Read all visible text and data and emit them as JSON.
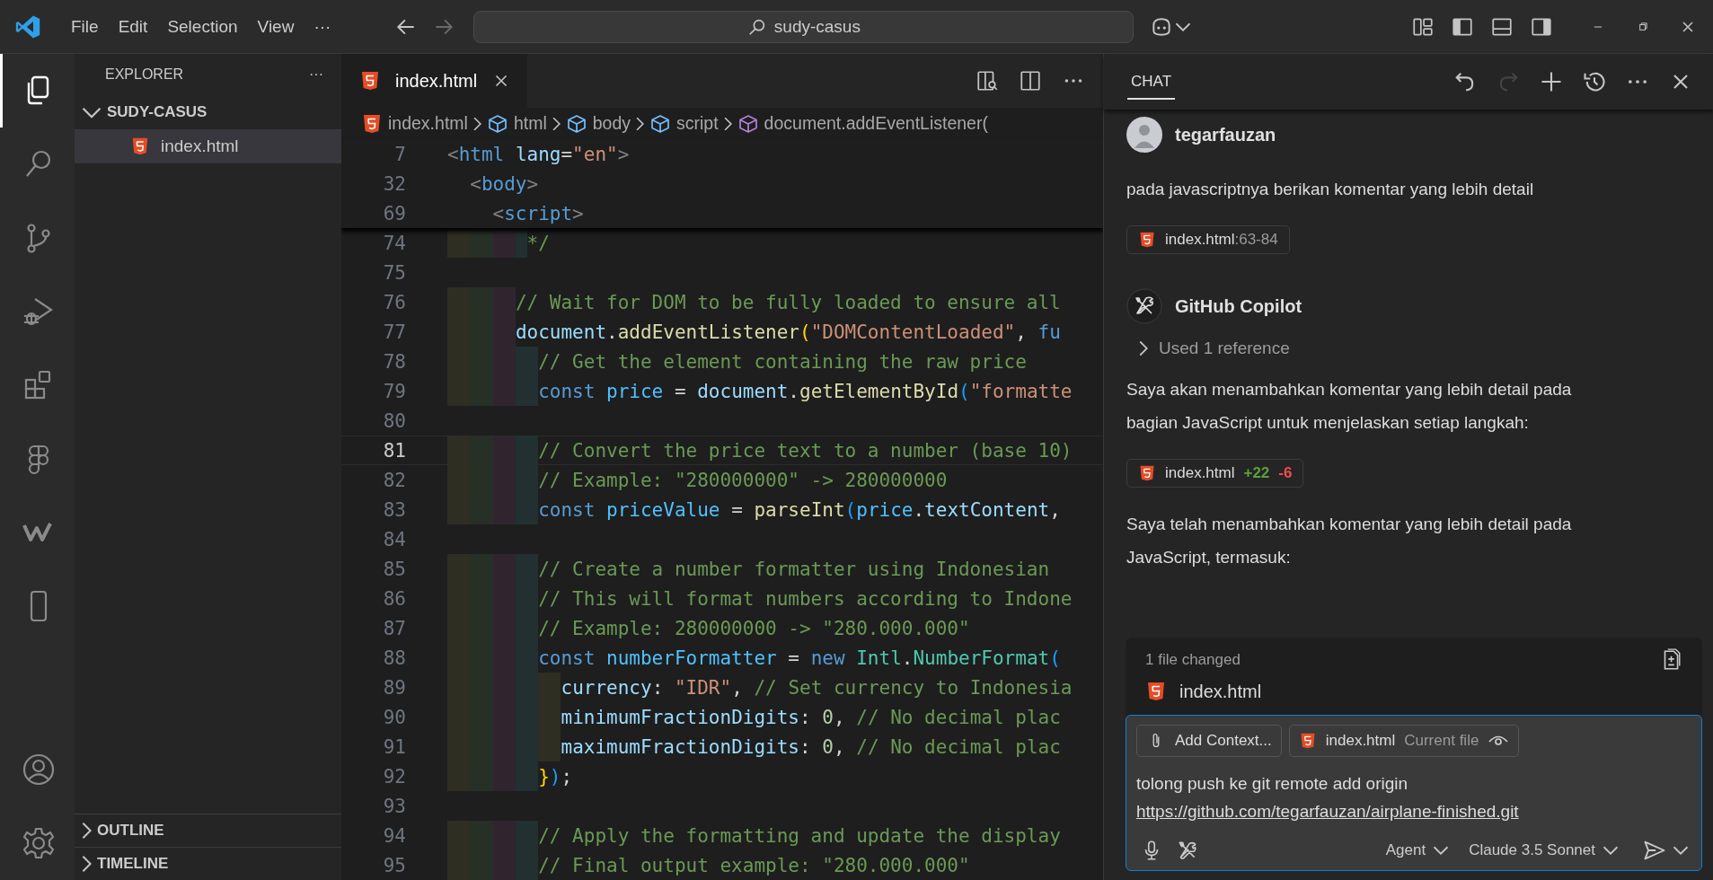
{
  "title_bar": {
    "menus": [
      "File",
      "Edit",
      "Selection",
      "View",
      "···"
    ],
    "search": "sudy-casus"
  },
  "activity_bar": {
    "items": [
      {
        "kind": "files",
        "selected": true
      },
      {
        "kind": "search",
        "selected": false
      },
      {
        "kind": "branch",
        "selected": false
      },
      {
        "kind": "debug",
        "selected": false
      },
      {
        "kind": "extensions",
        "selected": false
      },
      {
        "kind": "figma",
        "selected": false
      },
      {
        "kind": "wave",
        "selected": false
      },
      {
        "kind": "phone",
        "selected": false
      }
    ],
    "bottom": [
      {
        "kind": "account"
      },
      {
        "kind": "gear"
      }
    ]
  },
  "sidebar": {
    "title": "EXPLORER",
    "more": "···",
    "folder": {
      "name": "SUDY-CASUS",
      "expanded": true,
      "children": [
        {
          "name": "index.html",
          "selected": true
        }
      ]
    },
    "sections": [
      {
        "name": "OUTLINE",
        "expanded": false
      },
      {
        "name": "TIMELINE",
        "expanded": false
      }
    ]
  },
  "editor": {
    "tabs": [
      {
        "label": "index.html",
        "selected": true
      }
    ],
    "breadcrumb": [
      {
        "kind": "file",
        "text": "index.html"
      },
      {
        "kind": "element",
        "text": "html"
      },
      {
        "kind": "element",
        "text": "body"
      },
      {
        "kind": "element",
        "text": "script"
      },
      {
        "kind": "method",
        "text": "document.addEventListener("
      }
    ],
    "sticky_lines": [
      {
        "number": "7",
        "tokens": [
          {
            "kind": "tagpunct",
            "text": "<"
          },
          {
            "kind": "tag",
            "text": "html"
          },
          {
            "kind": "attr",
            "text": " lang"
          },
          {
            "kind": "plain",
            "text": "="
          },
          {
            "kind": "string",
            "text": "\"en\""
          },
          {
            "kind": "tagpunct",
            "text": ">"
          }
        ]
      },
      {
        "number": "32",
        "tokens": [
          {
            "kind": "tagpunct",
            "text": "  <"
          },
          {
            "kind": "tag",
            "text": "body"
          },
          {
            "kind": "tagpunct",
            "text": ">"
          }
        ]
      },
      {
        "number": "69",
        "tokens": [
          {
            "kind": "tagpunct",
            "text": "    <"
          },
          {
            "kind": "tag",
            "text": "script"
          },
          {
            "kind": "tagpunct",
            "text": ">"
          }
        ]
      }
    ],
    "lines": [
      {
        "number": "74",
        "current": false,
        "tokens": [
          {
            "kind": "comment",
            "text": "       */"
          }
        ]
      },
      {
        "number": "75",
        "current": false
      },
      {
        "number": "76",
        "current": false,
        "tokens": [
          {
            "kind": "comment",
            "text": "      // Wait for DOM to be fully loaded to ensure all"
          }
        ]
      },
      {
        "number": "77",
        "current": false,
        "tokens": [
          {
            "kind": "variable",
            "text": "      document"
          },
          {
            "kind": "plain",
            "text": "."
          },
          {
            "kind": "function",
            "text": "addEventListener"
          },
          {
            "kind": "bracket1",
            "text": "("
          },
          {
            "kind": "string",
            "text": "\"DOMContentLoaded\""
          },
          {
            "kind": "plain",
            "text": ", "
          },
          {
            "kind": "keyword",
            "text": "fu"
          }
        ]
      },
      {
        "number": "78",
        "current": false,
        "tokens": [
          {
            "kind": "comment",
            "text": "        // Get the element containing the raw price"
          }
        ]
      },
      {
        "number": "79",
        "current": false,
        "tokens": [
          {
            "kind": "keyword",
            "text": "        const "
          },
          {
            "kind": "constant",
            "text": "price"
          },
          {
            "kind": "plain",
            "text": " = "
          },
          {
            "kind": "variable",
            "text": "document"
          },
          {
            "kind": "plain",
            "text": "."
          },
          {
            "kind": "function",
            "text": "getElementById"
          },
          {
            "kind": "bracket2",
            "text": "("
          },
          {
            "kind": "string",
            "text": "\"formatte"
          }
        ]
      },
      {
        "number": "80",
        "current": false
      },
      {
        "number": "81",
        "current": true,
        "tokens": [
          {
            "kind": "comment",
            "text": "        // Convert the price text to a number (base 10)"
          }
        ]
      },
      {
        "number": "82",
        "current": false,
        "tokens": [
          {
            "kind": "comment",
            "text": "        // Example: \"280000000\" -> 280000000"
          }
        ]
      },
      {
        "number": "83",
        "current": false,
        "tokens": [
          {
            "kind": "keyword",
            "text": "        const "
          },
          {
            "kind": "constant",
            "text": "priceValue"
          },
          {
            "kind": "plain",
            "text": " = "
          },
          {
            "kind": "function",
            "text": "parseInt"
          },
          {
            "kind": "bracket2",
            "text": "("
          },
          {
            "kind": "constant",
            "text": "price"
          },
          {
            "kind": "plain",
            "text": "."
          },
          {
            "kind": "variable",
            "text": "textContent"
          },
          {
            "kind": "plain",
            "text": ","
          }
        ]
      },
      {
        "number": "84",
        "current": false
      },
      {
        "number": "85",
        "current": false,
        "tokens": [
          {
            "kind": "comment",
            "text": "        // Create a number formatter using Indonesian"
          }
        ]
      },
      {
        "number": "86",
        "current": false,
        "tokens": [
          {
            "kind": "comment",
            "text": "        // This will format numbers according to Indone"
          }
        ]
      },
      {
        "number": "87",
        "current": false,
        "tokens": [
          {
            "kind": "comment",
            "text": "        // Example: 280000000 -> \"280.000.000\""
          }
        ]
      },
      {
        "number": "88",
        "current": false,
        "tokens": [
          {
            "kind": "keyword",
            "text": "        const "
          },
          {
            "kind": "constant",
            "text": "numberFormatter"
          },
          {
            "kind": "plain",
            "text": " = "
          },
          {
            "kind": "keyword",
            "text": "new "
          },
          {
            "kind": "class",
            "text": "Intl"
          },
          {
            "kind": "plain",
            "text": "."
          },
          {
            "kind": "class",
            "text": "NumberFormat"
          },
          {
            "kind": "bracket2",
            "text": "("
          }
        ]
      },
      {
        "number": "89",
        "current": false,
        "tokens": [
          {
            "kind": "variable",
            "text": "          currency"
          },
          {
            "kind": "plain",
            "text": ": "
          },
          {
            "kind": "string",
            "text": "\"IDR\""
          },
          {
            "kind": "plain",
            "text": ", "
          },
          {
            "kind": "comment",
            "text": "// Set currency to Indonesia"
          }
        ]
      },
      {
        "number": "90",
        "current": false,
        "tokens": [
          {
            "kind": "variable",
            "text": "          minimumFractionDigits"
          },
          {
            "kind": "plain",
            "text": ": "
          },
          {
            "kind": "number",
            "text": "0"
          },
          {
            "kind": "plain",
            "text": ", "
          },
          {
            "kind": "comment",
            "text": "// No decimal plac"
          }
        ]
      },
      {
        "number": "91",
        "current": false,
        "tokens": [
          {
            "kind": "variable",
            "text": "          maximumFractionDigits"
          },
          {
            "kind": "plain",
            "text": ": "
          },
          {
            "kind": "number",
            "text": "0"
          },
          {
            "kind": "plain",
            "text": ", "
          },
          {
            "kind": "comment",
            "text": "// No decimal plac"
          }
        ]
      },
      {
        "number": "92",
        "current": false,
        "tokens": [
          {
            "kind": "bracket1",
            "text": "        }"
          },
          {
            "kind": "bracket2",
            "text": ")"
          },
          {
            "kind": "plain",
            "text": ";"
          }
        ]
      },
      {
        "number": "93",
        "current": false
      },
      {
        "number": "94",
        "current": false,
        "tokens": [
          {
            "kind": "comment",
            "text": "        // Apply the formatting and update the display"
          }
        ]
      },
      {
        "number": "95",
        "current": false,
        "tokens": [
          {
            "kind": "comment",
            "text": "        // Final output example: \"280.000.000\""
          }
        ]
      }
    ]
  },
  "chat": {
    "title": "CHAT",
    "actions": [
      {
        "kind": "undo",
        "disabled": false
      },
      {
        "kind": "redo",
        "disabled": true
      },
      {
        "kind": "plus",
        "disabled": false
      },
      {
        "kind": "history",
        "disabled": false
      },
      {
        "kind": "more",
        "disabled": false
      },
      {
        "kind": "close",
        "disabled": false
      }
    ],
    "messages": [
      {
        "kind": "user",
        "author": "tegarfauzan",
        "blocks": [
          {
            "kind": "text",
            "text": "pada javascriptnya berikan komentar yang lebih detail"
          },
          {
            "kind": "reference",
            "file": "index.html",
            "range": ":63-84"
          }
        ]
      },
      {
        "kind": "assistant",
        "author": "GitHub Copilot",
        "blocks": [
          {
            "kind": "used",
            "text": "Used 1 reference",
            "expanded": false
          },
          {
            "kind": "text",
            "text": "Saya akan menambahkan komentar yang lebih detail pada bagian JavaScript untuk menjelaskan setiap langkah:"
          },
          {
            "kind": "edit",
            "file": "index.html",
            "added": "+22",
            "removed": "-6"
          },
          {
            "kind": "text",
            "text": "Saya telah menambahkan komentar yang lebih detail pada JavaScript, termasuk:"
          }
        ]
      }
    ],
    "changes": {
      "summary": "1 file changed",
      "files": [
        "index.html"
      ]
    },
    "input": {
      "attachments": [
        {
          "kind": "add",
          "label": "Add Context..."
        },
        {
          "kind": "file",
          "label": "index.html",
          "note": "Current file"
        }
      ],
      "text": "tolong push ke git remote add origin",
      "link": "https://github.com/tegarfauzan/airplane-finished.git",
      "mode": "Agent",
      "model": "Claude 3.5 Sonnet"
    }
  }
}
